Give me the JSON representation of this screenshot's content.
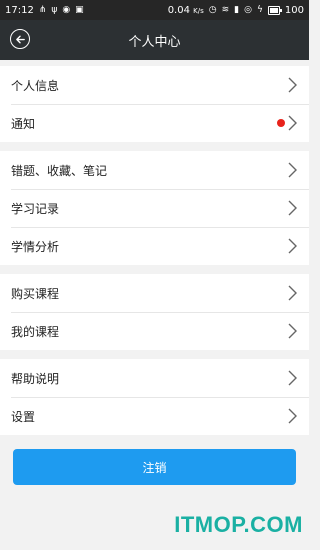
{
  "status_bar": {
    "time": "17:12",
    "network_speed": "0.04",
    "speed_unit": "K/s",
    "battery": "100",
    "battery_level": 1.0
  },
  "header": {
    "title": "个人中心",
    "back_icon": "back-arrow-circle-icon"
  },
  "groups": [
    [
      {
        "label": "个人信息"
      },
      {
        "label": "通知",
        "has_badge": true
      }
    ],
    [
      {
        "label": "错题、收藏、笔记"
      },
      {
        "label": "学习记录"
      },
      {
        "label": "学情分析"
      }
    ],
    [
      {
        "label": "购买课程"
      },
      {
        "label": "我的课程"
      }
    ],
    [
      {
        "label": "帮助说明"
      },
      {
        "label": "设置"
      }
    ]
  ],
  "logout_label": "注销",
  "watermark": "ITMOP.COM",
  "colors": {
    "header_bg": "#2c3033",
    "accent": "#1e9bf0",
    "badge": "#e8231b",
    "watermark": "#1ab0a3"
  }
}
